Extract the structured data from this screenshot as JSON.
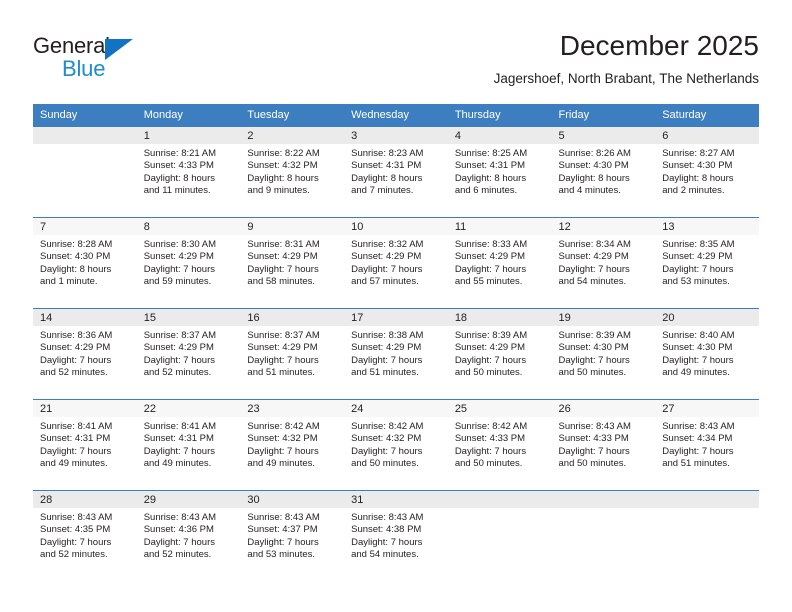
{
  "brand": {
    "name_part1": "General",
    "name_part2": "Blue",
    "logo_icon": "triangle-icon",
    "accent_color": "#1e8bd6"
  },
  "header": {
    "month_title": "December 2025",
    "location": "Jagershoef, North Brabant, The Netherlands"
  },
  "calendar": {
    "header_bg": "#3c7ebf",
    "weekday_headers": [
      "Sunday",
      "Monday",
      "Tuesday",
      "Wednesday",
      "Thursday",
      "Friday",
      "Saturday"
    ],
    "weeks": [
      [
        {
          "day": "",
          "sunrise": "",
          "sunset": "",
          "daylight_line1": "",
          "daylight_line2": ""
        },
        {
          "day": "1",
          "sunrise": "Sunrise: 8:21 AM",
          "sunset": "Sunset: 4:33 PM",
          "daylight_line1": "Daylight: 8 hours",
          "daylight_line2": "and 11 minutes."
        },
        {
          "day": "2",
          "sunrise": "Sunrise: 8:22 AM",
          "sunset": "Sunset: 4:32 PM",
          "daylight_line1": "Daylight: 8 hours",
          "daylight_line2": "and 9 minutes."
        },
        {
          "day": "3",
          "sunrise": "Sunrise: 8:23 AM",
          "sunset": "Sunset: 4:31 PM",
          "daylight_line1": "Daylight: 8 hours",
          "daylight_line2": "and 7 minutes."
        },
        {
          "day": "4",
          "sunrise": "Sunrise: 8:25 AM",
          "sunset": "Sunset: 4:31 PM",
          "daylight_line1": "Daylight: 8 hours",
          "daylight_line2": "and 6 minutes."
        },
        {
          "day": "5",
          "sunrise": "Sunrise: 8:26 AM",
          "sunset": "Sunset: 4:30 PM",
          "daylight_line1": "Daylight: 8 hours",
          "daylight_line2": "and 4 minutes."
        },
        {
          "day": "6",
          "sunrise": "Sunrise: 8:27 AM",
          "sunset": "Sunset: 4:30 PM",
          "daylight_line1": "Daylight: 8 hours",
          "daylight_line2": "and 2 minutes."
        }
      ],
      [
        {
          "day": "7",
          "sunrise": "Sunrise: 8:28 AM",
          "sunset": "Sunset: 4:30 PM",
          "daylight_line1": "Daylight: 8 hours",
          "daylight_line2": "and 1 minute."
        },
        {
          "day": "8",
          "sunrise": "Sunrise: 8:30 AM",
          "sunset": "Sunset: 4:29 PM",
          "daylight_line1": "Daylight: 7 hours",
          "daylight_line2": "and 59 minutes."
        },
        {
          "day": "9",
          "sunrise": "Sunrise: 8:31 AM",
          "sunset": "Sunset: 4:29 PM",
          "daylight_line1": "Daylight: 7 hours",
          "daylight_line2": "and 58 minutes."
        },
        {
          "day": "10",
          "sunrise": "Sunrise: 8:32 AM",
          "sunset": "Sunset: 4:29 PM",
          "daylight_line1": "Daylight: 7 hours",
          "daylight_line2": "and 57 minutes."
        },
        {
          "day": "11",
          "sunrise": "Sunrise: 8:33 AM",
          "sunset": "Sunset: 4:29 PM",
          "daylight_line1": "Daylight: 7 hours",
          "daylight_line2": "and 55 minutes."
        },
        {
          "day": "12",
          "sunrise": "Sunrise: 8:34 AM",
          "sunset": "Sunset: 4:29 PM",
          "daylight_line1": "Daylight: 7 hours",
          "daylight_line2": "and 54 minutes."
        },
        {
          "day": "13",
          "sunrise": "Sunrise: 8:35 AM",
          "sunset": "Sunset: 4:29 PM",
          "daylight_line1": "Daylight: 7 hours",
          "daylight_line2": "and 53 minutes."
        }
      ],
      [
        {
          "day": "14",
          "sunrise": "Sunrise: 8:36 AM",
          "sunset": "Sunset: 4:29 PM",
          "daylight_line1": "Daylight: 7 hours",
          "daylight_line2": "and 52 minutes."
        },
        {
          "day": "15",
          "sunrise": "Sunrise: 8:37 AM",
          "sunset": "Sunset: 4:29 PM",
          "daylight_line1": "Daylight: 7 hours",
          "daylight_line2": "and 52 minutes."
        },
        {
          "day": "16",
          "sunrise": "Sunrise: 8:37 AM",
          "sunset": "Sunset: 4:29 PM",
          "daylight_line1": "Daylight: 7 hours",
          "daylight_line2": "and 51 minutes."
        },
        {
          "day": "17",
          "sunrise": "Sunrise: 8:38 AM",
          "sunset": "Sunset: 4:29 PM",
          "daylight_line1": "Daylight: 7 hours",
          "daylight_line2": "and 51 minutes."
        },
        {
          "day": "18",
          "sunrise": "Sunrise: 8:39 AM",
          "sunset": "Sunset: 4:29 PM",
          "daylight_line1": "Daylight: 7 hours",
          "daylight_line2": "and 50 minutes."
        },
        {
          "day": "19",
          "sunrise": "Sunrise: 8:39 AM",
          "sunset": "Sunset: 4:30 PM",
          "daylight_line1": "Daylight: 7 hours",
          "daylight_line2": "and 50 minutes."
        },
        {
          "day": "20",
          "sunrise": "Sunrise: 8:40 AM",
          "sunset": "Sunset: 4:30 PM",
          "daylight_line1": "Daylight: 7 hours",
          "daylight_line2": "and 49 minutes."
        }
      ],
      [
        {
          "day": "21",
          "sunrise": "Sunrise: 8:41 AM",
          "sunset": "Sunset: 4:31 PM",
          "daylight_line1": "Daylight: 7 hours",
          "daylight_line2": "and 49 minutes."
        },
        {
          "day": "22",
          "sunrise": "Sunrise: 8:41 AM",
          "sunset": "Sunset: 4:31 PM",
          "daylight_line1": "Daylight: 7 hours",
          "daylight_line2": "and 49 minutes."
        },
        {
          "day": "23",
          "sunrise": "Sunrise: 8:42 AM",
          "sunset": "Sunset: 4:32 PM",
          "daylight_line1": "Daylight: 7 hours",
          "daylight_line2": "and 49 minutes."
        },
        {
          "day": "24",
          "sunrise": "Sunrise: 8:42 AM",
          "sunset": "Sunset: 4:32 PM",
          "daylight_line1": "Daylight: 7 hours",
          "daylight_line2": "and 50 minutes."
        },
        {
          "day": "25",
          "sunrise": "Sunrise: 8:42 AM",
          "sunset": "Sunset: 4:33 PM",
          "daylight_line1": "Daylight: 7 hours",
          "daylight_line2": "and 50 minutes."
        },
        {
          "day": "26",
          "sunrise": "Sunrise: 8:43 AM",
          "sunset": "Sunset: 4:33 PM",
          "daylight_line1": "Daylight: 7 hours",
          "daylight_line2": "and 50 minutes."
        },
        {
          "day": "27",
          "sunrise": "Sunrise: 8:43 AM",
          "sunset": "Sunset: 4:34 PM",
          "daylight_line1": "Daylight: 7 hours",
          "daylight_line2": "and 51 minutes."
        }
      ],
      [
        {
          "day": "28",
          "sunrise": "Sunrise: 8:43 AM",
          "sunset": "Sunset: 4:35 PM",
          "daylight_line1": "Daylight: 7 hours",
          "daylight_line2": "and 52 minutes."
        },
        {
          "day": "29",
          "sunrise": "Sunrise: 8:43 AM",
          "sunset": "Sunset: 4:36 PM",
          "daylight_line1": "Daylight: 7 hours",
          "daylight_line2": "and 52 minutes."
        },
        {
          "day": "30",
          "sunrise": "Sunrise: 8:43 AM",
          "sunset": "Sunset: 4:37 PM",
          "daylight_line1": "Daylight: 7 hours",
          "daylight_line2": "and 53 minutes."
        },
        {
          "day": "31",
          "sunrise": "Sunrise: 8:43 AM",
          "sunset": "Sunset: 4:38 PM",
          "daylight_line1": "Daylight: 7 hours",
          "daylight_line2": "and 54 minutes."
        },
        {
          "day": "",
          "sunrise": "",
          "sunset": "",
          "daylight_line1": "",
          "daylight_line2": ""
        },
        {
          "day": "",
          "sunrise": "",
          "sunset": "",
          "daylight_line1": "",
          "daylight_line2": ""
        },
        {
          "day": "",
          "sunrise": "",
          "sunset": "",
          "daylight_line1": "",
          "daylight_line2": ""
        }
      ]
    ]
  }
}
